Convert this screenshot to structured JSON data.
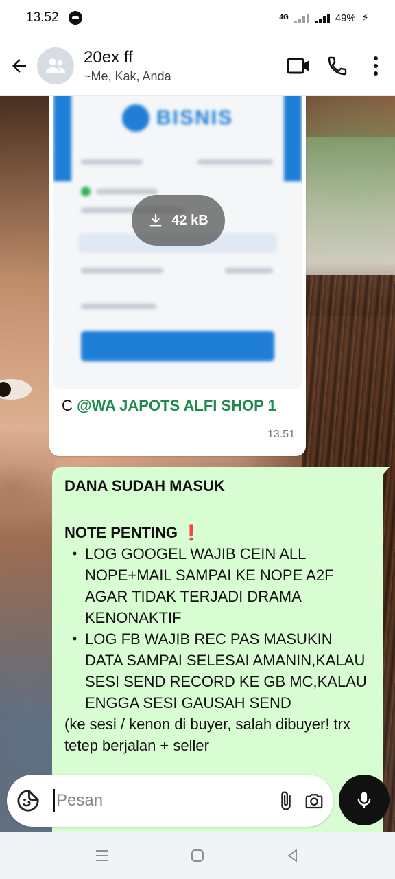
{
  "status_bar": {
    "time": "13.52",
    "network": "4G",
    "battery": "49%"
  },
  "header": {
    "title": "20ex ff",
    "subtitle": "~Me, Kak, Anda"
  },
  "messages": {
    "image_message": {
      "download_size": "42 kB",
      "blurred_brand": "BISNIS",
      "caption_prefix": "C ",
      "caption_mention": "@WA JAPOTS ALFI SHOP 1",
      "time": "13.51"
    },
    "text_message": {
      "line1": "DANA SUDAH MASUK",
      "heading": "NOTE PENTING",
      "heading_emoji": "❗",
      "bullets": [
        "LOG GOOGEL WAJIB CEIN ALL NOPE+MAIL SAMPAI KE NOPE A2F AGAR TIDAK TERJADI DRAMA KENONAKTIF",
        "LOG FB WAJIB REC PAS MASUKIN DATA SAMPAI SELESAI AMANIN,KALAU SESI SEND RECORD KE GB MC,KALAU ENGGA SESI GAUSAH SEND"
      ],
      "footer": "(ke sesi / kenon di buyer, salah dibuyer! trx tetep berjalan + seller"
    }
  },
  "composer": {
    "placeholder": "Pesan"
  },
  "colors": {
    "sent_bubble": "#d9fdd3",
    "mention": "#1f8a4c",
    "accent_blue": "#1f7fd6"
  },
  "icons": {
    "back": "arrow-left-icon",
    "avatar": "group-icon",
    "video": "video-camera-icon",
    "call": "phone-icon",
    "menu": "more-vertical-icon",
    "download": "download-icon",
    "sticker": "sticker-icon",
    "attach": "paperclip-icon",
    "camera": "camera-icon",
    "mic": "microphone-icon"
  }
}
